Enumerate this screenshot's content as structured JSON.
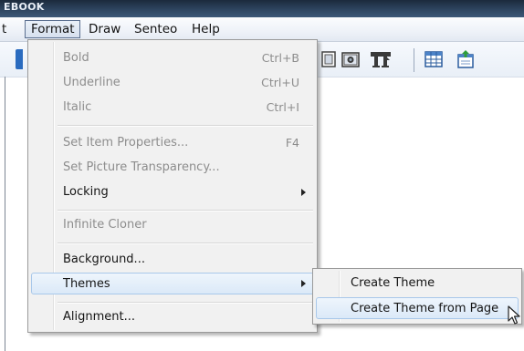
{
  "window": {
    "title_fragment": "EBOOK"
  },
  "menubar": {
    "items": [
      {
        "label": "t",
        "active": false
      },
      {
        "label": "Format",
        "active": true
      },
      {
        "label": "Draw",
        "active": false
      },
      {
        "label": "Senteo",
        "active": false
      },
      {
        "label": "Help",
        "active": false
      }
    ]
  },
  "toolbar": {
    "icons": [
      "picture-frame-icon",
      "camera-icon",
      "table-tool-icon",
      "table-icon",
      "attachment-icon"
    ]
  },
  "format_menu": {
    "items": [
      {
        "label": "Bold",
        "shortcut": "Ctrl+B",
        "enabled": false
      },
      {
        "label": "Underline",
        "shortcut": "Ctrl+U",
        "enabled": false
      },
      {
        "label": "Italic",
        "shortcut": "Ctrl+I",
        "enabled": false
      },
      {
        "label": "Set Item Properties...",
        "shortcut": "F4",
        "enabled": false
      },
      {
        "label": "Set Picture Transparency...",
        "shortcut": "",
        "enabled": false
      },
      {
        "label": "Locking",
        "shortcut": "",
        "enabled": true,
        "submenu": true
      },
      {
        "label": "Infinite Cloner",
        "shortcut": "",
        "enabled": false
      },
      {
        "label": "Background...",
        "shortcut": "",
        "enabled": true
      },
      {
        "label": "Themes",
        "shortcut": "",
        "enabled": true,
        "submenu": true,
        "highlighted": true
      },
      {
        "label": "Alignment...",
        "shortcut": "",
        "enabled": true
      }
    ]
  },
  "themes_submenu": {
    "items": [
      {
        "label": "Create Theme",
        "highlighted": false
      },
      {
        "label": "Create Theme from Page",
        "highlighted": true
      }
    ]
  },
  "colors": {
    "menu_highlight_border": "#a9c8ea",
    "menu_background": "#f1f1f1",
    "disabled_text": "#8d8d8d"
  }
}
